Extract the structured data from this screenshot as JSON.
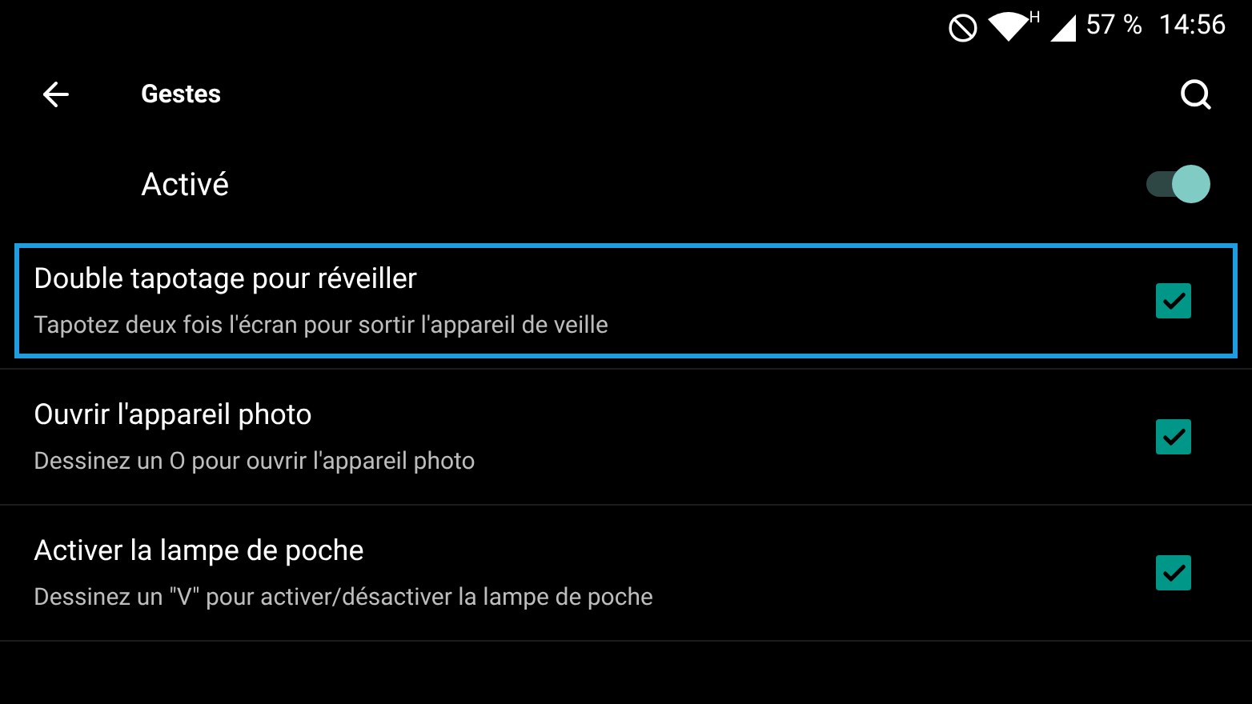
{
  "status_bar": {
    "battery": "57 %",
    "time": "14:56",
    "network": "H"
  },
  "toolbar": {
    "title": "Gestes"
  },
  "master_switch": {
    "label": "Activé",
    "on": true
  },
  "gestures": [
    {
      "title": "Double tapotage pour réveiller",
      "subtitle": "Tapotez deux fois l'écran pour sortir l'appareil de veille",
      "checked": true,
      "focused": true
    },
    {
      "title": "Ouvrir l'appareil photo",
      "subtitle": "Dessinez un O pour ouvrir l'appareil photo",
      "checked": true,
      "focused": false
    },
    {
      "title": "Activer la lampe de poche",
      "subtitle": "Dessinez un \"V\" pour activer/désactiver la lampe de poche",
      "checked": true,
      "focused": false
    }
  ]
}
